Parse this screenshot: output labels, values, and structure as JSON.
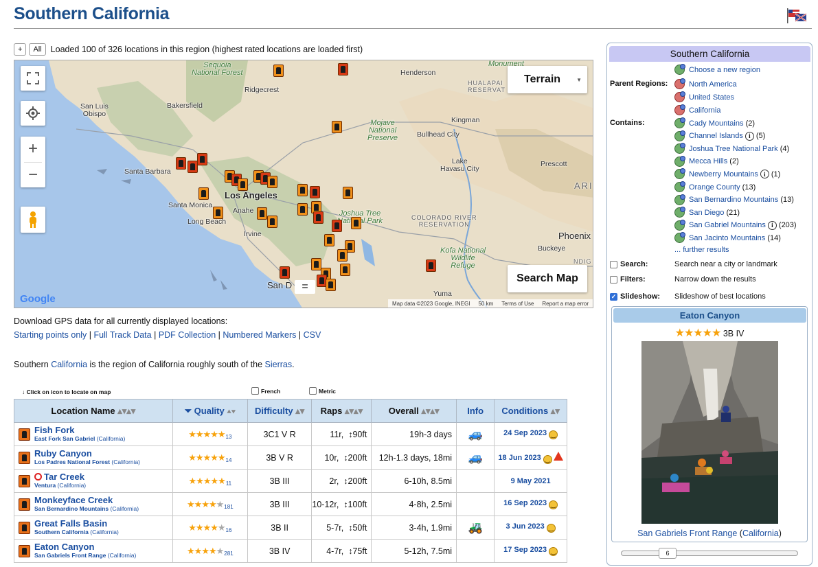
{
  "page": {
    "title": "Southern California"
  },
  "loadbar": {
    "plus": "+",
    "all": "All",
    "text": "Loaded 100 of 326 locations in this region (highest rated locations are loaded first)"
  },
  "map": {
    "terrain_label": "Terrain",
    "search_label": "Search Map",
    "zoom_in": "+",
    "zoom_out": "−",
    "google": "Google",
    "eq": "=",
    "attribution": {
      "data": "Map data ©2023 Google, INEGI",
      "scale": "50 km",
      "terms": "Terms of Use",
      "report": "Report a map error"
    },
    "places": {
      "sequoia": "Sequoia\nNational Forest",
      "henderson": "Henderson",
      "monument": "Monument",
      "hualapai": "HUALAPAI\nRESERVAT",
      "ridgecrest": "Ridgecrest",
      "sanluis": "San Luis\nObispo",
      "bakersfield": "Bakersfield",
      "kingman": "Kingman",
      "mojave": "Mojave\nNational\nPreserve",
      "bullhead": "Bullhead City",
      "santabarbara": "Santa Barbara",
      "lake": "Lake\nHavasu City",
      "prescott": "Prescott",
      "ari": "ARI",
      "losangeles": "Los Angeles",
      "santamonica": "Santa Monica",
      "anaheim": "Anahe",
      "longbeach": "Long Beach",
      "joshua": "Joshua Tree\nNational Park",
      "colorado": "COLORADO RIVER\nRESERVATION",
      "irvine": "Irvine",
      "phoenix": "Phoenix",
      "buckeye": "Buckeye",
      "kofa": "Kofa National\nWildlife\nRefuge",
      "sandiego": "San D",
      "yuma": "Yuma",
      "ndig": "NDIG"
    }
  },
  "downloads": {
    "label": "Download GPS data for all currently displayed locations:",
    "links": [
      "Starting points only",
      "Full Track Data",
      "PDF Collection",
      "Numbered Markers",
      "CSV"
    ],
    "sep": "|"
  },
  "description": {
    "pre": "Southern ",
    "link1": "California",
    "mid": " is the region of California roughly south of the ",
    "link2": "Sierras",
    "post": "."
  },
  "table_tools": {
    "hint": "↓ Click on icon to locate on map",
    "french": "French",
    "metric": "Metric"
  },
  "table": {
    "headers": {
      "name": "Location Name",
      "quality": "Quality",
      "difficulty": "Difficulty",
      "raps": "Raps",
      "overall": "Overall",
      "info": "Info",
      "conditions": "Conditions"
    },
    "rows": [
      {
        "name": "Fish Fork",
        "region": "East Fork San Gabriel",
        "state": "California",
        "stars": 5,
        "count": "13",
        "difficulty": "3C1 V R",
        "raps": "11r,",
        "rap_len": "↕90ft",
        "overall": "19h-3 days",
        "dist": "",
        "info": "car",
        "date": "24 Sep 2023",
        "face": "smile",
        "warn": false
      },
      {
        "name": "Ruby Canyon",
        "region": "Los Padres National Forest",
        "state": "California",
        "stars": 4.5,
        "count": "14",
        "difficulty": "3B V R",
        "raps": "10r,",
        "rap_len": "↕200ft",
        "overall": "12h-1.3 days,",
        "dist": "18mi",
        "info": "car",
        "date": "18 Jun 2023",
        "face": "smile",
        "warn": true
      },
      {
        "name": "Tar Creek",
        "region": "Ventura",
        "state": "California",
        "stars": 4.5,
        "count": "11",
        "difficulty": "3B III",
        "raps": "2r,",
        "rap_len": "↕200ft",
        "overall": "6-10h,",
        "dist": "8.5mi",
        "info": "",
        "date": "9 May 2021",
        "face": "",
        "warn": false,
        "closed": true
      },
      {
        "name": "Monkeyface Creek",
        "region": "San Bernardino Mountains",
        "state": "California",
        "stars": 4,
        "count": "181",
        "difficulty": "3B III",
        "raps": "10-12r,",
        "rap_len": "↕100ft",
        "overall": "4-8h,",
        "dist": "2.5mi",
        "info": "",
        "date": "16 Sep 2023",
        "face": "smile",
        "warn": false
      },
      {
        "name": "Great Falls Basin",
        "region": "Southern California",
        "state": "California",
        "stars": 4,
        "count": "16",
        "difficulty": "3B II",
        "raps": "5-7r,",
        "rap_len": "↕50ft",
        "overall": "3-4h,",
        "dist": "1.9mi",
        "info": "jeep",
        "date": "3 Jun 2023",
        "face": "smile",
        "warn": false
      },
      {
        "name": "Eaton Canyon",
        "region": "San Gabriels Front Range",
        "state": "California",
        "stars": 4,
        "count": "281",
        "difficulty": "3B IV",
        "raps": "4-7r,",
        "rap_len": "↕75ft",
        "overall": "5-12h,",
        "dist": "7.5mi",
        "info": "",
        "date": "17 Sep 2023",
        "face": "smile",
        "warn": false
      }
    ]
  },
  "sidebar": {
    "title": "Southern California",
    "choose": "Choose a new region",
    "parent_label": "Parent Regions:",
    "parents": [
      "North America",
      "United States",
      "California"
    ],
    "contains_label": "Contains:",
    "contains": [
      {
        "name": "Cady Mountains",
        "count": "(2)",
        "info": false
      },
      {
        "name": "Channel Islands",
        "count": "(5)",
        "info": true
      },
      {
        "name": "Joshua Tree National Park",
        "count": "(4)",
        "info": false
      },
      {
        "name": "Mecca Hills",
        "count": "(2)",
        "info": false
      },
      {
        "name": "Newberry Mountains",
        "count": "(1)",
        "info": true
      },
      {
        "name": "Orange County",
        "count": "(13)",
        "info": false
      },
      {
        "name": "San Bernardino Mountains",
        "count": "(13)",
        "info": false
      },
      {
        "name": "San Diego",
        "count": "(21)",
        "info": false
      },
      {
        "name": "San Gabriel Mountains",
        "count": "(203)",
        "info": true
      },
      {
        "name": "San Jacinto Mountains",
        "count": "(14)",
        "info": false
      }
    ],
    "further": "... further results",
    "search_label": "Search:",
    "search_desc": "Search near a city or landmark",
    "filters_label": "Filters:",
    "filters_desc": "Narrow down the results",
    "slideshow_label": "Slideshow:",
    "slideshow_desc": "Slideshow of best locations",
    "slideshow": {
      "title": "Eaton Canyon",
      "rating": "3B IV",
      "stars": 4.5,
      "caption_pre": "San Gabriels Front Range",
      "caption_link": "California",
      "slider_value": "6"
    }
  },
  "colors": {
    "accent": "#1a4ea0",
    "title": "#1c4f8a",
    "header_bg": "#cfe1f1",
    "sidebar_head": "#c8c8f3",
    "star": "#f7a20c"
  }
}
